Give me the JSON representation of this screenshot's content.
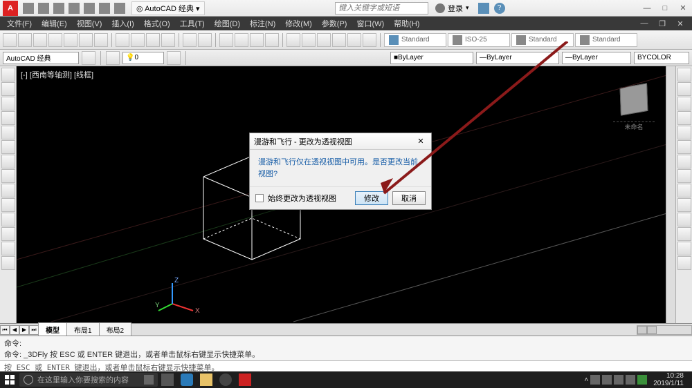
{
  "app": {
    "workspace": "AutoCAD 经典",
    "search_placeholder": "键入关键字或短语",
    "login": "登录"
  },
  "menus": [
    "文件(F)",
    "编辑(E)",
    "视图(V)",
    "插入(I)",
    "格式(O)",
    "工具(T)",
    "绘图(D)",
    "标注(N)",
    "修改(M)",
    "参数(P)",
    "窗口(W)",
    "帮助(H)"
  ],
  "styles": {
    "text": "Standard",
    "dim": "ISO-25",
    "table": "Standard",
    "mleader": "Standard"
  },
  "layer_row": {
    "workspace": "AutoCAD 经典",
    "layer_state": "0",
    "prop1": "ByLayer",
    "prop2": "ByLayer",
    "prop3": "ByLayer",
    "prop4": "BYCOLOR"
  },
  "viewport_label": "[-] [西南等轴测] [线框]",
  "compass_label": "未命名",
  "ucs": {
    "x": "X",
    "y": "Y",
    "z": "Z"
  },
  "dialog": {
    "title": "漫游和飞行 - 更改为透视视图",
    "message": "漫游和飞行仅在透视视图中可用。是否更改当前视图?",
    "checkbox": "始终更改为透视视图",
    "ok": "修改",
    "cancel": "取消"
  },
  "tabs": {
    "model": "模型",
    "layout1": "布局1",
    "layout2": "布局2"
  },
  "cmd": {
    "line1": "命令:",
    "line2": "命令: _3DFly 按 ESC 或 ENTER 键退出，或者单击鼠标右键显示快捷菜单。",
    "input": "按 ESC 或 ENTER 键退出，或者单击鼠标右键显示快捷菜单。"
  },
  "taskbar": {
    "search": "在这里输入你要搜索的内容",
    "time": "10:28",
    "date": "2019/1/11"
  }
}
